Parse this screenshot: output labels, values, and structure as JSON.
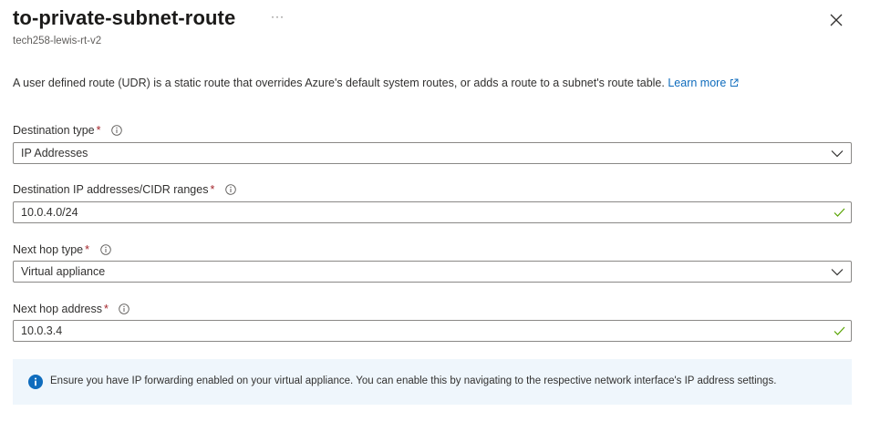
{
  "header": {
    "title": "to-private-subnet-route",
    "subtitle": "tech258-lewis-rt-v2",
    "more_label": "···"
  },
  "description": {
    "text": "A user defined route (UDR) is a static route that overrides Azure's default system routes, or adds a route to a subnet's route table.",
    "link_label": "Learn more"
  },
  "fields": {
    "destination_type": {
      "label": "Destination type",
      "required_marker": "*",
      "value": "IP Addresses"
    },
    "destination_ip": {
      "label": "Destination IP addresses/CIDR ranges",
      "required_marker": "*",
      "value": "10.0.4.0/24"
    },
    "next_hop_type": {
      "label": "Next hop type",
      "required_marker": "*",
      "value": "Virtual appliance"
    },
    "next_hop_address": {
      "label": "Next hop address",
      "required_marker": "*",
      "value": "10.0.3.4"
    }
  },
  "info_banner": {
    "text": "Ensure you have IP forwarding enabled on your virtual appliance. You can enable this by navigating to the respective network interface's IP address settings."
  },
  "colors": {
    "accent": "#0f6cbd",
    "required": "#a4262c",
    "valid": "#57a300",
    "info_background": "#eff6fc"
  }
}
